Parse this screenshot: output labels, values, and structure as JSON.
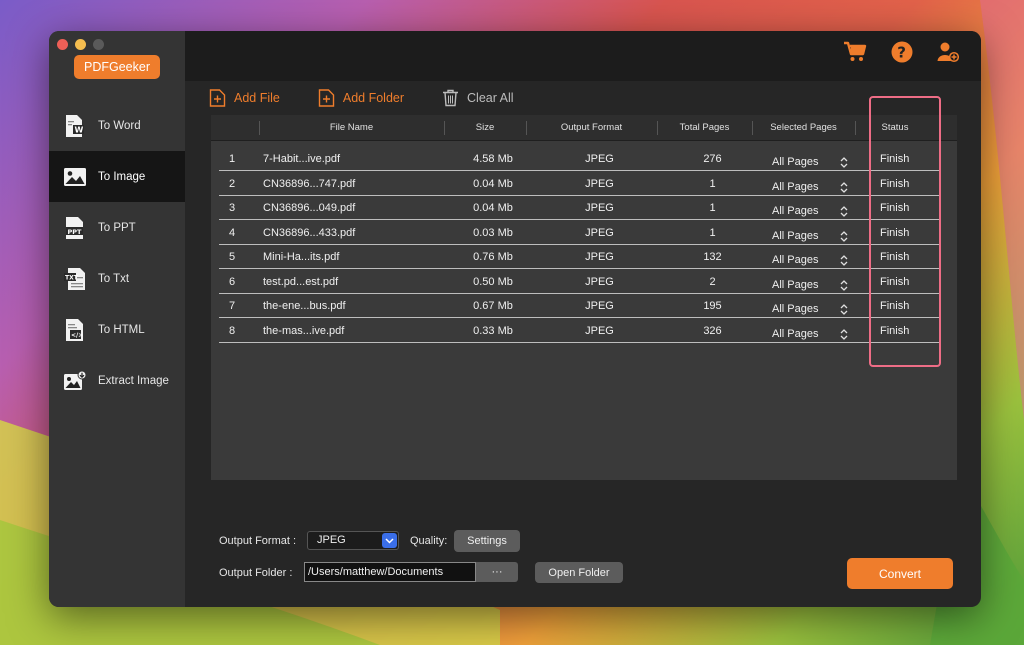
{
  "app": {
    "brand": "PDFGeeker"
  },
  "sidebar": {
    "items": [
      {
        "label": "To Word",
        "icon": "word-doc-icon",
        "active": false
      },
      {
        "label": "To Image",
        "icon": "image-icon",
        "active": true
      },
      {
        "label": "To PPT",
        "icon": "ppt-doc-icon",
        "active": false
      },
      {
        "label": "To Txt",
        "icon": "txt-doc-icon",
        "active": false
      },
      {
        "label": "To HTML",
        "icon": "html-doc-icon",
        "active": false
      },
      {
        "label": "Extract Image",
        "icon": "extract-image-icon",
        "active": false
      }
    ]
  },
  "header": {
    "icons": [
      "cart-icon",
      "help-icon",
      "user-add-icon"
    ],
    "accent": "#ef7d2c"
  },
  "toolbar": {
    "add_file": "Add File",
    "add_folder": "Add Folder",
    "clear_all": "Clear All"
  },
  "table": {
    "columns": [
      "File Name",
      "Size",
      "Output Format",
      "Total Pages",
      "Selected Pages",
      "Status"
    ],
    "rows": [
      {
        "num": "1",
        "name": "7-Habit...ive.pdf",
        "size": "4.58 Mb",
        "format": "JPEG",
        "pages": "276",
        "selected": "All Pages",
        "status": "Finish"
      },
      {
        "num": "2",
        "name": "CN36896...747.pdf",
        "size": "0.04 Mb",
        "format": "JPEG",
        "pages": "1",
        "selected": "All Pages",
        "status": "Finish"
      },
      {
        "num": "3",
        "name": "CN36896...049.pdf",
        "size": "0.04 Mb",
        "format": "JPEG",
        "pages": "1",
        "selected": "All Pages",
        "status": "Finish"
      },
      {
        "num": "4",
        "name": "CN36896...433.pdf",
        "size": "0.03 Mb",
        "format": "JPEG",
        "pages": "1",
        "selected": "All Pages",
        "status": "Finish"
      },
      {
        "num": "5",
        "name": "Mini-Ha...its.pdf",
        "size": "0.76 Mb",
        "format": "JPEG",
        "pages": "132",
        "selected": "All Pages",
        "status": "Finish"
      },
      {
        "num": "6",
        "name": "test.pd...est.pdf",
        "size": "0.50 Mb",
        "format": "JPEG",
        "pages": "2",
        "selected": "All Pages",
        "status": "Finish"
      },
      {
        "num": "7",
        "name": "the-ene...bus.pdf",
        "size": "0.67 Mb",
        "format": "JPEG",
        "pages": "195",
        "selected": "All Pages",
        "status": "Finish"
      },
      {
        "num": "8",
        "name": "the-mas...ive.pdf",
        "size": "0.33 Mb",
        "format": "JPEG",
        "pages": "326",
        "selected": "All Pages",
        "status": "Finish"
      }
    ]
  },
  "bottom": {
    "output_format_label": "Output Format :",
    "output_format_value": "JPEG",
    "quality_label": "Quality:",
    "settings_button": "Settings",
    "output_folder_label": "Output Folder :",
    "output_folder_value": "/Users/matthew/Documents",
    "browse_button": "···",
    "open_folder_button": "Open Folder",
    "convert_button": "Convert"
  }
}
